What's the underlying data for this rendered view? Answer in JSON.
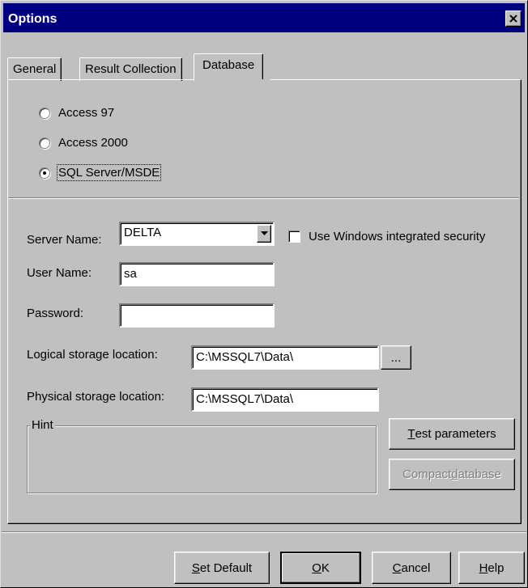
{
  "window": {
    "title": "Options"
  },
  "tabs": [
    {
      "label": "General"
    },
    {
      "label": "Result Collection"
    },
    {
      "label": "Database"
    }
  ],
  "database": {
    "radios": [
      {
        "label": "Access 97",
        "checked": false
      },
      {
        "label": "Access 2000",
        "checked": false
      },
      {
        "label": "SQL Server/MSDE",
        "checked": true
      }
    ],
    "server_name_label": "Server Name:",
    "server_name_value": "DELTA",
    "windows_security_label": "Use Windows integrated security",
    "windows_security_checked": false,
    "user_name_label": "User Name:",
    "user_name_value": "sa",
    "password_label": "Password:",
    "password_value": "",
    "logical_label": "Logical storage location:",
    "logical_value": "C:\\MSSQL7\\Data\\",
    "browse_label": "...",
    "physical_label": "Physical storage location:",
    "physical_value": "C:\\MSSQL7\\Data\\",
    "hint_label": "Hint",
    "test_button": {
      "prefix": "",
      "accel": "T",
      "rest": "est parameters"
    },
    "compact_button": {
      "prefix": "Compact ",
      "accel": "d",
      "rest": "atabase"
    }
  },
  "footer": {
    "set_default": {
      "prefix": "",
      "accel": "S",
      "rest": "et Default"
    },
    "ok": {
      "prefix": "",
      "accel": "O",
      "rest": "K"
    },
    "cancel": {
      "prefix": "",
      "accel": "C",
      "rest": "ancel"
    },
    "help": {
      "prefix": "",
      "accel": "H",
      "rest": "elp"
    }
  },
  "icons": {
    "close": "close-icon",
    "dropdown": "chevron-down-icon"
  }
}
